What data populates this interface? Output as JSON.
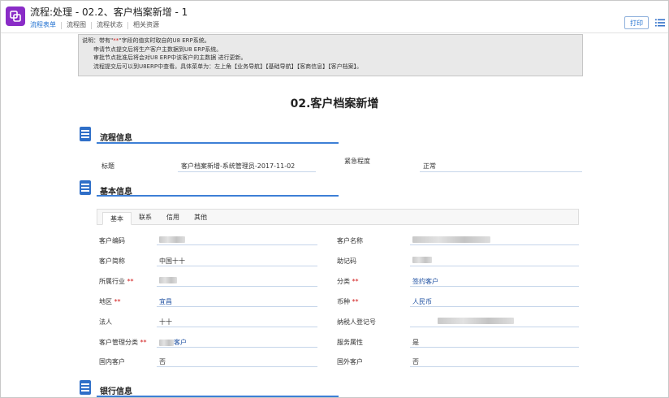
{
  "header": {
    "title": "流程:处理 - 02.2、客户档案新增 - 1",
    "tabs": [
      "流程表单",
      "流程图",
      "流程状态",
      "相关资源"
    ],
    "print_label": "打印"
  },
  "notice": {
    "line1_prefix": "说明：带有\"",
    "line1_mark": "**",
    "line1_suffix": "\"字段的值实时取自的U8 ERP系统。",
    "line2": "申请节点提交后将生产客户主数据到U8 ERP系统。",
    "line3": "审批节点批准后将会对U8 ERP中该客户的主数据 进行更新。",
    "line4": "流程提交后可以到U8ERP中查看。具体菜单为：左上角【业务导航】【基础导航】【客商信息】【客户档案】。"
  },
  "form_title": "02.客户档案新增",
  "process_section": {
    "title": "流程信息",
    "title_label": "标题",
    "title_value": "客户档案新增-系统管理员-2017-11-02",
    "urgency_label": "紧急程度",
    "urgency_value": "正常"
  },
  "basic_section": {
    "title": "基本信息",
    "tabs": [
      "基本",
      "联系",
      "信用",
      "其他"
    ],
    "required_mark": "**",
    "fields": {
      "customer_code_label": "客户编码",
      "customer_name_label": "客户名称",
      "short_name_label": "客户简称",
      "short_name_value": "中国十十",
      "mnemonic_label": "助记码",
      "industry_label": "所属行业",
      "category_label": "分类",
      "category_value": "签约客户",
      "region_label": "地区",
      "region_value": "宜昌",
      "currency_label": "币种",
      "currency_value": "人民币",
      "legal_person_label": "法人",
      "legal_person_value": "十十",
      "taxpayer_label": "纳税人登记号",
      "manage_class_label": "客户管理分类",
      "manage_class_value": "客户",
      "service_attr_label": "服务属性",
      "service_attr_value": "是",
      "domestic_label": "国内客户",
      "domestic_value": "否",
      "foreign_label": "国外客户",
      "foreign_value": "否"
    }
  },
  "bank_section": {
    "title": "银行信息"
  },
  "colors": {
    "accent": "#1e6fd0",
    "logo": "#8a2cc7",
    "section_icon": "#2f6fc8",
    "required": "#d21b1b"
  }
}
